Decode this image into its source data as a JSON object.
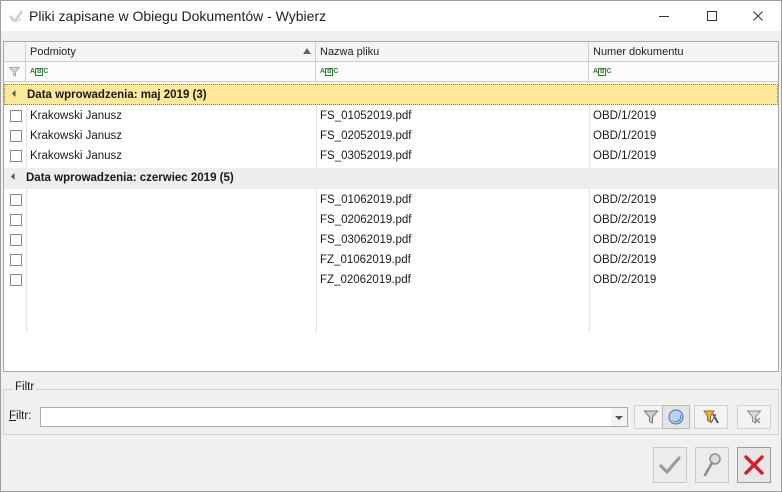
{
  "window": {
    "title": "Pliki zapisane w Obiegu Dokumentów - Wybierz"
  },
  "grid": {
    "columns": [
      {
        "key": "podmioty",
        "label": "Podmioty",
        "sorted": "asc"
      },
      {
        "key": "nazwa",
        "label": "Nazwa pliku"
      },
      {
        "key": "numer",
        "label": "Numer dokumentu"
      }
    ],
    "groups": [
      {
        "label": "Data wprowadzenia: maj 2019 (3)",
        "selected": true,
        "rows": [
          {
            "podmioty": "Krakowski Janusz",
            "nazwa": "FS_01052019.pdf",
            "numer": "OBD/1/2019",
            "checked": false
          },
          {
            "podmioty": "Krakowski Janusz",
            "nazwa": "FS_02052019.pdf",
            "numer": "OBD/1/2019",
            "checked": false
          },
          {
            "podmioty": "Krakowski Janusz",
            "nazwa": "FS_03052019.pdf",
            "numer": "OBD/1/2019",
            "checked": false
          }
        ]
      },
      {
        "label": "Data wprowadzenia: czerwiec 2019 (5)",
        "selected": false,
        "rows": [
          {
            "podmioty": "",
            "nazwa": "FS_01062019.pdf",
            "numer": "OBD/2/2019",
            "checked": false
          },
          {
            "podmioty": "",
            "nazwa": "FS_02062019.pdf",
            "numer": "OBD/2/2019",
            "checked": false
          },
          {
            "podmioty": "",
            "nazwa": "FS_03062019.pdf",
            "numer": "OBD/2/2019",
            "checked": false
          },
          {
            "podmioty": "",
            "nazwa": "FZ_01062019.pdf",
            "numer": "OBD/2/2019",
            "checked": false
          },
          {
            "podmioty": "",
            "nazwa": "FZ_02062019.pdf",
            "numer": "OBD/2/2019",
            "checked": false
          }
        ]
      }
    ]
  },
  "filter": {
    "group_label": "Filtr",
    "label_accel": "F",
    "label_rest": "iltr:",
    "value": "",
    "placeholder": ""
  },
  "icons": {
    "minimize": "minimize-icon",
    "maximize": "maximize-icon",
    "close": "close-icon",
    "filter": "funnel-icon",
    "clear_filter": "clear-filter-icon",
    "confirm": "check-icon",
    "cancel": "cancel-x-icon"
  },
  "colors": {
    "group_selected_bg": "#fbe89a",
    "group_bg": "#eeeeee",
    "cancel_red": "#d0202a"
  }
}
